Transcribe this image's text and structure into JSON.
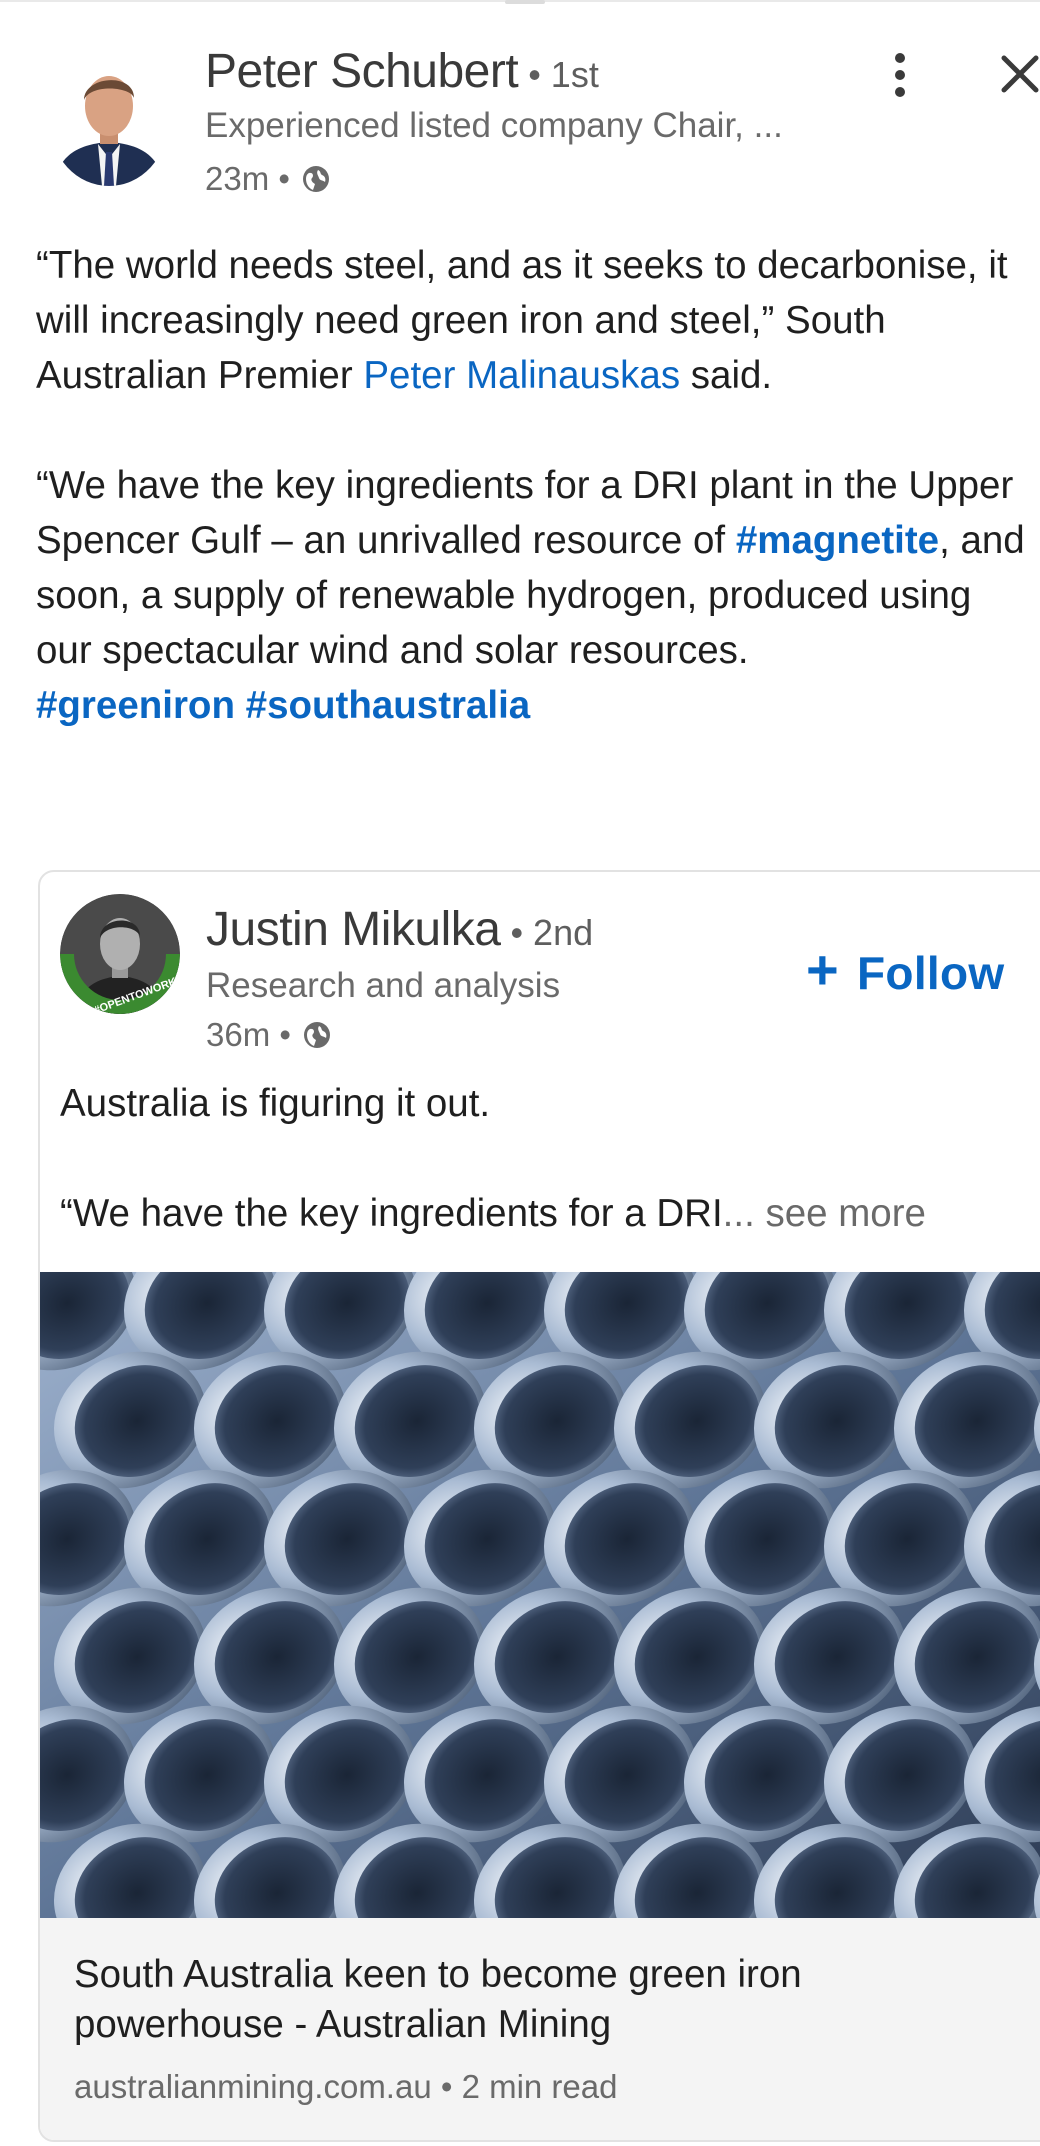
{
  "post": {
    "author": {
      "name": "Peter Schubert",
      "degree": "• 1st",
      "headline": "Experienced listed company Chair, ...",
      "time": "23m •"
    },
    "body": {
      "line1_pre": "“The world needs steel, and as it seeks to decarbonise, it will increasingly need green iron and steel,” South Australian Premier ",
      "mention": "Peter Malinauskas",
      "line1_post": " said.",
      "line2_pre": "“We have the key ingredients for a DRI plant in the Upper Spencer Gulf – an unrivalled resource of ",
      "hashtag_magnetite": "#magnetite",
      "line2_post": ", and soon, a supply of renewable hydrogen, produced using our spectacular wind and solar resources.",
      "hashtags_line": "#greeniron #southaustralia"
    }
  },
  "reshare": {
    "author": {
      "name": "Justin Mikulka",
      "degree": "• 2nd",
      "headline": "Research and analysis",
      "time": "36m •",
      "badge": "#OPENTOWORK"
    },
    "follow_label": "Follow",
    "text_line1": "Australia is figuring it out.",
    "text_line2": "“We have the key ingredients for a DRI",
    "see_more": "... see more",
    "link": {
      "title": "South Australia keen to become green iron powerhouse - Australian Mining",
      "source": "australianmining.com.au • 2 min read"
    }
  },
  "colors": {
    "link_blue": "#0a66c2",
    "text": "#1f1f1f",
    "muted": "#6a6a6a",
    "open_to_work_green": "#3b8a30"
  },
  "icons": [
    "globe-icon",
    "more-vertical-icon",
    "close-icon",
    "plus-icon"
  ]
}
